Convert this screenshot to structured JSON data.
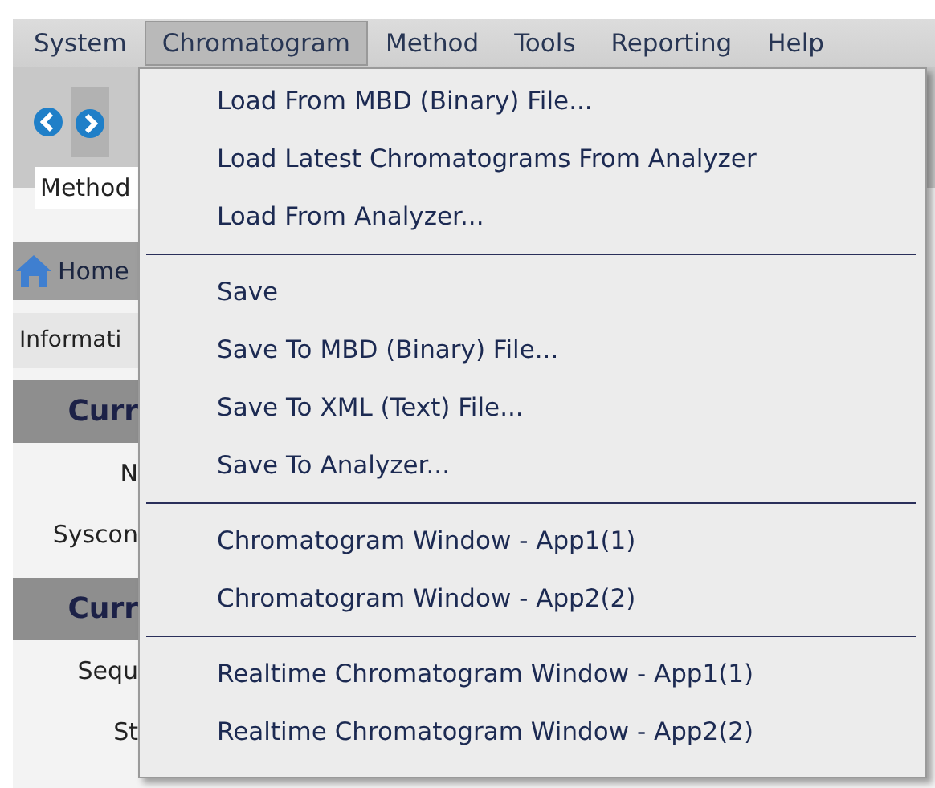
{
  "menu_bar": [
    {
      "label": "System",
      "selected": false
    },
    {
      "label": "Chromatogram",
      "selected": true
    },
    {
      "label": "Method",
      "selected": false
    },
    {
      "label": "Tools",
      "selected": false
    },
    {
      "label": "Reporting",
      "selected": false
    },
    {
      "label": "Help",
      "selected": false
    }
  ],
  "toolbar": {
    "method_field": "Method"
  },
  "home_tab": "Home",
  "info_tab": "Informati",
  "panel": [
    {
      "kind": "header",
      "text": "Curr"
    },
    {
      "kind": "label",
      "text": "N"
    },
    {
      "kind": "label",
      "text": "Syscon"
    },
    {
      "kind": "header",
      "text": "Curr"
    },
    {
      "kind": "label",
      "text": "Sequ"
    },
    {
      "kind": "label",
      "text": "St"
    }
  ],
  "dropdown": {
    "groups": [
      [
        "Load From MBD (Binary) File...",
        "Load Latest Chromatograms From Analyzer",
        "Load From Analyzer..."
      ],
      [
        "Save",
        "Save To MBD (Binary) File...",
        "Save To XML (Text) File...",
        "Save To Analyzer..."
      ],
      [
        "Chromatogram Window - App1(1)",
        "Chromatogram Window - App2(2)"
      ],
      [
        "Realtime Chromatogram Window - App1(1)",
        "Realtime Chromatogram Window - App2(2)"
      ]
    ]
  }
}
